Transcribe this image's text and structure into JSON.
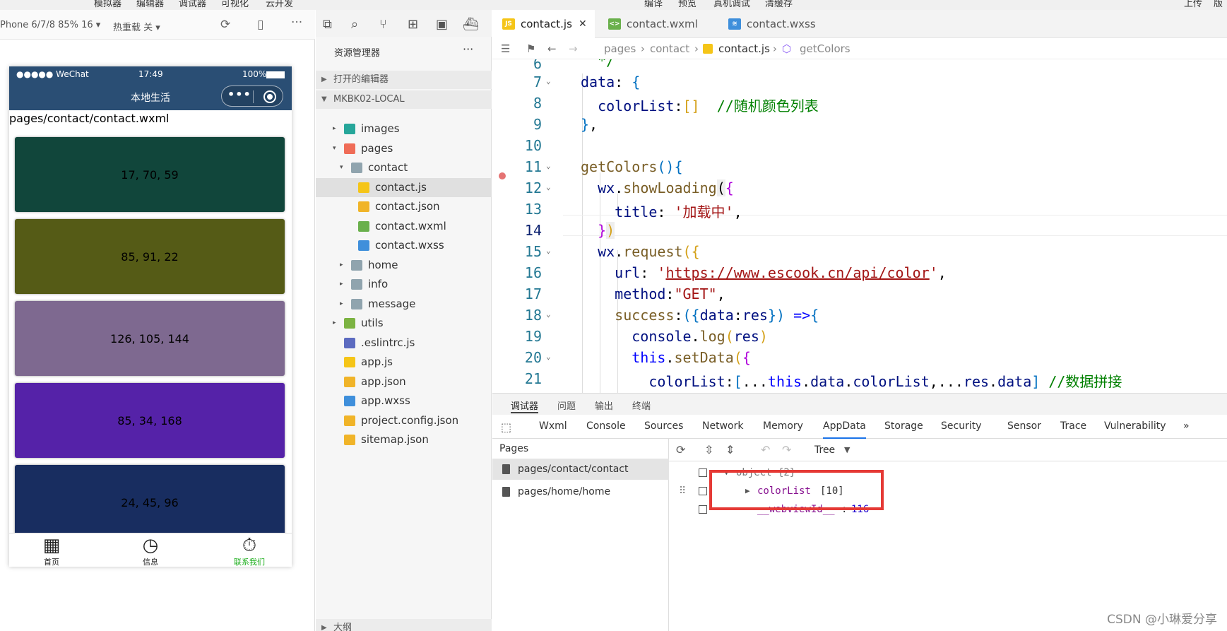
{
  "top_menu": [
    "模拟器",
    "编辑器",
    "调试器",
    "可视化",
    "云开发",
    "编译",
    "预览",
    "真机调试",
    "清缓存",
    "上传",
    "版"
  ],
  "simulator": {
    "device": "Phone 6/7/8 85% 16 ▾",
    "hot_reload": "热重载 关 ▾",
    "status_carrier": "●●●●● WeChat",
    "status_time": "17:49",
    "status_battery": "100%",
    "nav_title": "本地生活",
    "capsule_dots": "•••",
    "page_path": "pages/contact/contact.wxml",
    "colors": [
      {
        "label": "17, 70, 59",
        "color": "#11463b"
      },
      {
        "label": "85, 91, 22",
        "color": "#555b16"
      },
      {
        "label": "126, 105, 144",
        "color": "#7e6990"
      },
      {
        "label": "85, 34, 168",
        "color": "#5522a8"
      },
      {
        "label": "24, 45, 96",
        "color": "#182d60"
      }
    ],
    "tabbar": [
      {
        "icon": "calendar-icon",
        "label": "首页",
        "active": false
      },
      {
        "icon": "clock-icon",
        "label": "信息",
        "active": false
      },
      {
        "icon": "stopwatch-icon",
        "label": "联系我们",
        "active": true
      }
    ],
    "tab_active_color": "#1aad19"
  },
  "explorer": {
    "title": "资源管理器",
    "more": "···",
    "open_editors": "打开的编辑器",
    "project": "MKBK02-LOCAL",
    "tree": [
      {
        "name": "images",
        "depth": 0,
        "arrow": "▸",
        "icon": "folder-images-icon",
        "color": "#26a69a"
      },
      {
        "name": "pages",
        "depth": 0,
        "arrow": "▾",
        "icon": "folder-pages-icon",
        "color": "#ef6c57"
      },
      {
        "name": "contact",
        "depth": 1,
        "arrow": "▾",
        "icon": "folder-icon",
        "color": "#90a4ae"
      },
      {
        "name": "contact.js",
        "depth": 2,
        "arrow": "",
        "icon": "js-file-icon",
        "color": "#f5c518",
        "selected": true
      },
      {
        "name": "contact.json",
        "depth": 2,
        "arrow": "",
        "icon": "json-file-icon",
        "color": "#f0b429"
      },
      {
        "name": "contact.wxml",
        "depth": 2,
        "arrow": "",
        "icon": "wxml-file-icon",
        "color": "#6ab04c"
      },
      {
        "name": "contact.wxss",
        "depth": 2,
        "arrow": "",
        "icon": "wxss-file-icon",
        "color": "#3f8fdb"
      },
      {
        "name": "home",
        "depth": 1,
        "arrow": "▸",
        "icon": "folder-icon",
        "color": "#90a4ae"
      },
      {
        "name": "info",
        "depth": 1,
        "arrow": "▸",
        "icon": "folder-icon",
        "color": "#90a4ae"
      },
      {
        "name": "message",
        "depth": 1,
        "arrow": "▸",
        "icon": "folder-icon",
        "color": "#90a4ae"
      },
      {
        "name": "utils",
        "depth": 0,
        "arrow": "▸",
        "icon": "folder-utils-icon",
        "color": "#7cb342"
      },
      {
        "name": ".eslintrc.js",
        "depth": 0,
        "arrow": "",
        "icon": "eslint-file-icon",
        "color": "#5c6bc0"
      },
      {
        "name": "app.js",
        "depth": 0,
        "arrow": "",
        "icon": "js-file-icon",
        "color": "#f5c518"
      },
      {
        "name": "app.json",
        "depth": 0,
        "arrow": "",
        "icon": "json-file-icon",
        "color": "#f0b429"
      },
      {
        "name": "app.wxss",
        "depth": 0,
        "arrow": "",
        "icon": "wxss-file-icon",
        "color": "#3f8fdb"
      },
      {
        "name": "project.config.json",
        "depth": 0,
        "arrow": "",
        "icon": "json-file-icon",
        "color": "#f0b429"
      },
      {
        "name": "sitemap.json",
        "depth": 0,
        "arrow": "",
        "icon": "json-file-icon",
        "color": "#f0b429"
      }
    ],
    "outline": "大纲"
  },
  "editor": {
    "tabs": [
      {
        "label": "contact.js",
        "badge": "JS",
        "badge_color": "#f5c518",
        "active": true,
        "close": "✕"
      },
      {
        "label": "contact.wxml",
        "badge": "<>",
        "badge_color": "#6ab04c",
        "active": false
      },
      {
        "label": "contact.wxss",
        "badge": "≋",
        "badge_color": "#3f8fdb",
        "active": false
      }
    ],
    "breadcrumb": [
      "pages",
      "contact",
      "contact.js",
      "getColors"
    ]
  },
  "debugger": {
    "top_tabs": [
      "调试器",
      "问题",
      "输出",
      "终端"
    ],
    "panel_tabs": [
      "Wxml",
      "Console",
      "Sources",
      "Network",
      "Memory",
      "AppData",
      "Storage",
      "Security",
      "Sensor",
      "Trace",
      "Vulnerability",
      "»"
    ],
    "active_panel": "AppData",
    "pages_header": "Pages",
    "pages": [
      "pages/contact/contact",
      "pages/home/home"
    ],
    "view_mode": "Tree",
    "object_label": "object {2}",
    "colorlist_label": "colorList",
    "colorlist_count": "[10]",
    "webview_label": "__webviewId__",
    "webview_value": "116"
  },
  "watermark": "CSDN @小琳爱分享"
}
